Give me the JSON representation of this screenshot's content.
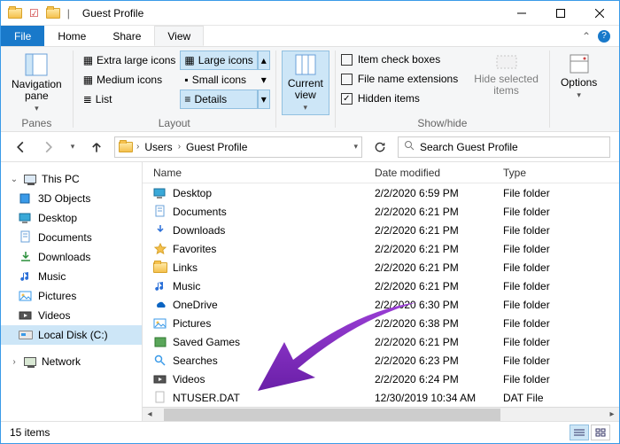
{
  "window": {
    "title": "Guest Profile"
  },
  "tabs": {
    "file": "File",
    "home": "Home",
    "share": "Share",
    "view": "View"
  },
  "ribbon": {
    "panes": {
      "nav_label": "Navigation\npane",
      "group": "Panes"
    },
    "layout": {
      "extra_large": "Extra large icons",
      "large": "Large icons",
      "medium": "Medium icons",
      "small": "Small icons",
      "list": "List",
      "details": "Details",
      "group": "Layout"
    },
    "current_view": {
      "label": "Current\nview",
      "group": ""
    },
    "showhide": {
      "item_check": "Item check boxes",
      "file_ext": "File name extensions",
      "hidden": "Hidden items",
      "hide_sel": "Hide selected\nitems",
      "group": "Show/hide"
    },
    "options": {
      "label": "Options"
    }
  },
  "addr": {
    "crumbs": [
      "Users",
      "Guest Profile"
    ],
    "search_placeholder": "Search Guest Profile"
  },
  "sidebar": {
    "this_pc": "This PC",
    "items": [
      "3D Objects",
      "Desktop",
      "Documents",
      "Downloads",
      "Music",
      "Pictures",
      "Videos",
      "Local Disk (C:)"
    ],
    "network": "Network"
  },
  "columns": {
    "name": "Name",
    "date": "Date modified",
    "type": "Type"
  },
  "rows": [
    {
      "icon": "desktop",
      "name": "Desktop",
      "date": "2/2/2020 6:59 PM",
      "type": "File folder"
    },
    {
      "icon": "documents",
      "name": "Documents",
      "date": "2/2/2020 6:21 PM",
      "type": "File folder"
    },
    {
      "icon": "downloads",
      "name": "Downloads",
      "date": "2/2/2020 6:21 PM",
      "type": "File folder"
    },
    {
      "icon": "favorites",
      "name": "Favorites",
      "date": "2/2/2020 6:21 PM",
      "type": "File folder"
    },
    {
      "icon": "links",
      "name": "Links",
      "date": "2/2/2020 6:21 PM",
      "type": "File folder"
    },
    {
      "icon": "music",
      "name": "Music",
      "date": "2/2/2020 6:21 PM",
      "type": "File folder"
    },
    {
      "icon": "onedrive",
      "name": "OneDrive",
      "date": "2/2/2020 6:30 PM",
      "type": "File folder"
    },
    {
      "icon": "pictures",
      "name": "Pictures",
      "date": "2/2/2020 6:38 PM",
      "type": "File folder"
    },
    {
      "icon": "saved",
      "name": "Saved Games",
      "date": "2/2/2020 6:21 PM",
      "type": "File folder"
    },
    {
      "icon": "searches",
      "name": "Searches",
      "date": "2/2/2020 6:23 PM",
      "type": "File folder"
    },
    {
      "icon": "videos",
      "name": "Videos",
      "date": "2/2/2020 6:24 PM",
      "type": "File folder"
    },
    {
      "icon": "file",
      "name": "NTUSER.DAT",
      "date": "12/30/2019 10:34 AM",
      "type": "DAT File"
    }
  ],
  "status": {
    "count": "15 items"
  }
}
